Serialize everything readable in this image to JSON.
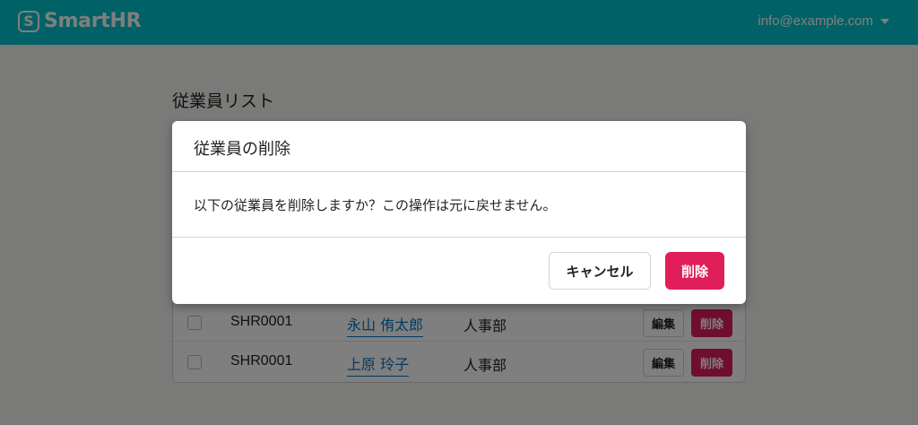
{
  "header": {
    "logo_mark": "S",
    "logo_text": "SmartHR",
    "account": "info@example.com",
    "bg_color": "#00c4cc",
    "icons": [
      "logo-icon",
      "caret-down-icon"
    ]
  },
  "main": {
    "title": "従業員リスト",
    "rows": [
      {
        "code": "SHR0001",
        "name": "永山 侑太郎",
        "department": "人事部",
        "edit_label": "編集",
        "delete_label": "削除"
      },
      {
        "code": "SHR0001",
        "name": "上原 玲子",
        "department": "人事部",
        "edit_label": "編集",
        "delete_label": "削除"
      }
    ]
  },
  "dialog": {
    "title": "従業員の削除",
    "message": "以下の従業員を削除しますか？この操作は元に戻せません。",
    "cancel_label": "キャンセル",
    "confirm_label": "削除",
    "danger_color": "#e01e5a"
  }
}
